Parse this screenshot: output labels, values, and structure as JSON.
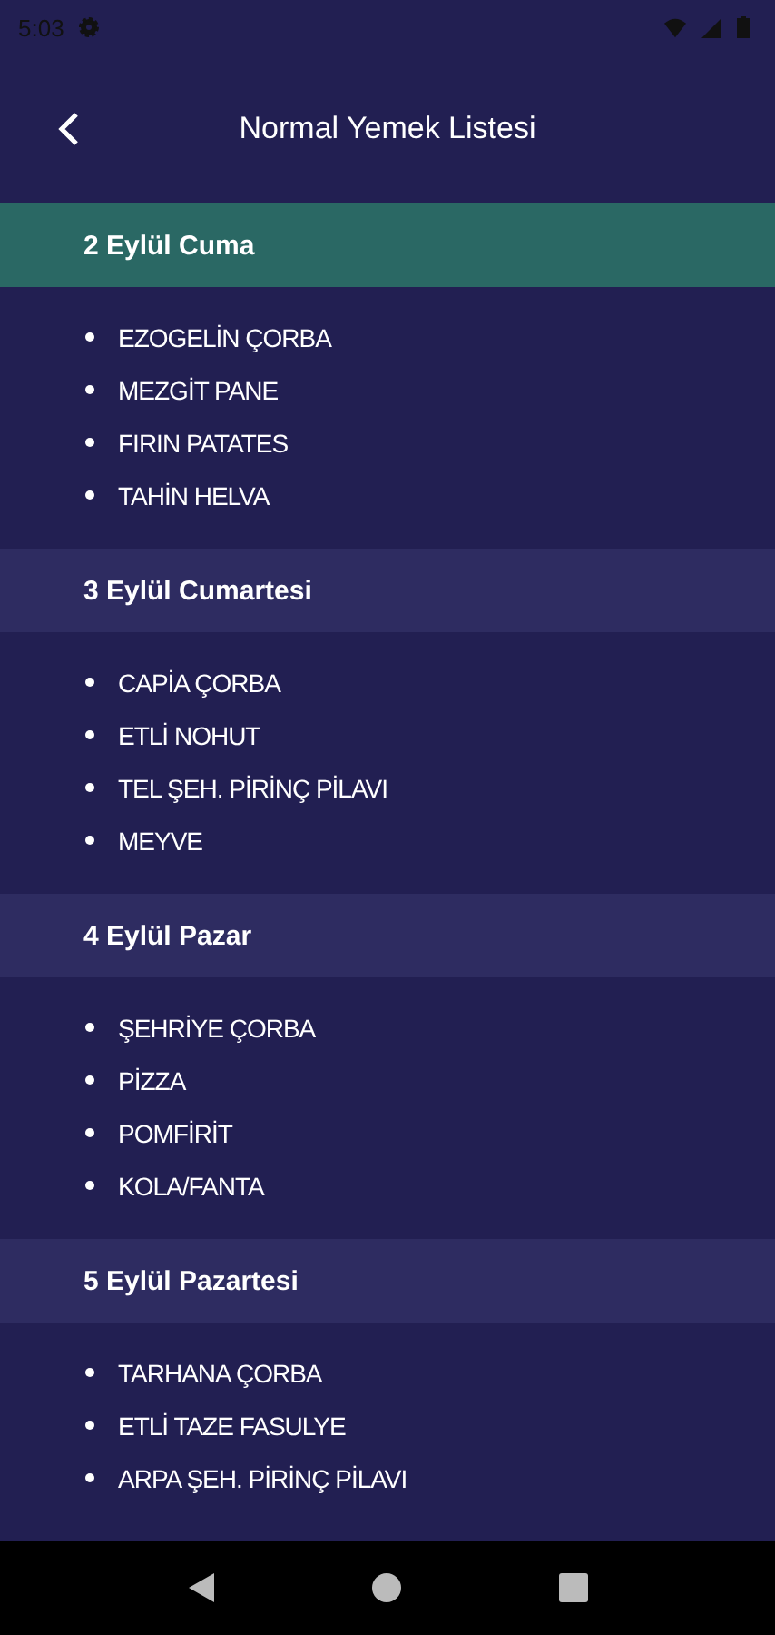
{
  "status_bar": {
    "time": "5:03"
  },
  "app_bar": {
    "title": "Normal Yemek Listesi"
  },
  "days": [
    {
      "title": "2 Eylül Cuma",
      "selected": true,
      "items": [
        "EZOGELİN ÇORBA",
        "MEZGİT PANE",
        "FIRIN PATATES",
        "TAHİN HELVA"
      ]
    },
    {
      "title": "3 Eylül Cumartesi",
      "selected": false,
      "items": [
        "CAPİA ÇORBA",
        "ETLİ NOHUT",
        "TEL ŞEH. PİRİNÇ PİLAVI",
        "MEYVE"
      ]
    },
    {
      "title": "4 Eylül Pazar",
      "selected": false,
      "items": [
        "ŞEHRİYE ÇORBA",
        "PİZZA",
        "POMFİRİT",
        "KOLA/FANTA"
      ]
    },
    {
      "title": "5 Eylül Pazartesi",
      "selected": false,
      "items": [
        "TARHANA ÇORBA",
        "ETLİ TAZE FASULYE",
        "ARPA ŞEH. PİRİNÇ PİLAVI"
      ]
    }
  ]
}
